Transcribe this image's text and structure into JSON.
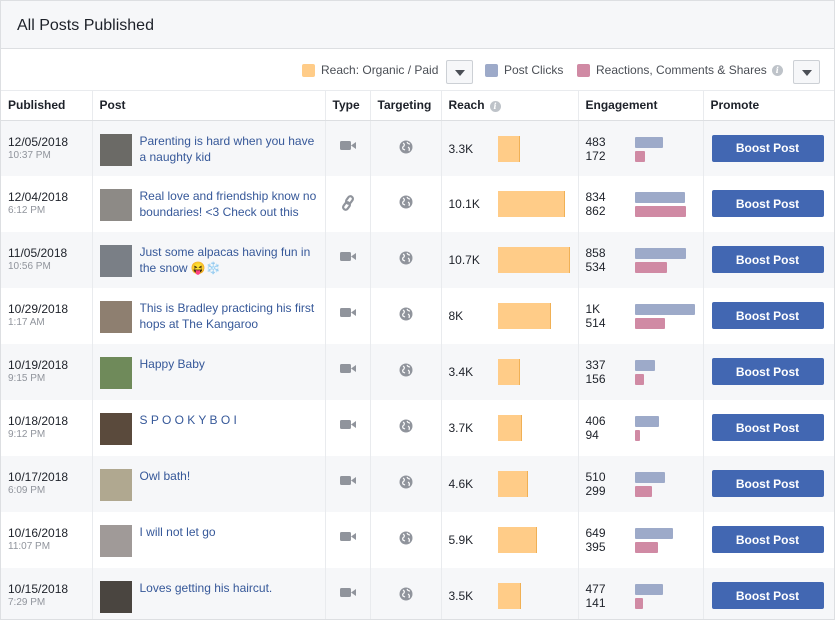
{
  "title": "All Posts Published",
  "legend": {
    "reach_label": "Reach: Organic / Paid",
    "clicks_label": "Post Clicks",
    "reactions_label": "Reactions, Comments & Shares",
    "reach_color": "#ffcc88",
    "clicks_color": "#9daac9",
    "reactions_color": "#d08aa4"
  },
  "columns": {
    "published": "Published",
    "post": "Post",
    "type": "Type",
    "targeting": "Targeting",
    "reach": "Reach",
    "engagement": "Engagement",
    "promote": "Promote"
  },
  "boost_label": "Boost Post",
  "reach_max": 10.7,
  "engagement_max": 1000,
  "posts": [
    {
      "date": "12/05/2018",
      "time": "10:37 PM",
      "text": "Parenting is hard when you have a naughty kid",
      "type": "video-icon",
      "reach": "3.3K",
      "reach_value": 3.3,
      "clicks": "483",
      "clicks_value": 483,
      "reactions": "172",
      "reactions_value": 172,
      "thumb": "#6b6a66"
    },
    {
      "date": "12/04/2018",
      "time": "6:12 PM",
      "text": "Real love and friendship know no boundaries! <3 Check out this",
      "type": "link-icon",
      "reach": "10.1K",
      "reach_value": 10.1,
      "clicks": "834",
      "clicks_value": 834,
      "reactions": "862",
      "reactions_value": 862,
      "thumb": "#8d8a86"
    },
    {
      "date": "11/05/2018",
      "time": "10:56 PM",
      "text": "Just some alpacas having fun in the snow 😝❄️",
      "type": "video-icon",
      "reach": "10.7K",
      "reach_value": 10.7,
      "clicks": "858",
      "clicks_value": 858,
      "reactions": "534",
      "reactions_value": 534,
      "thumb": "#7a7f86"
    },
    {
      "date": "10/29/2018",
      "time": "1:17 AM",
      "text": "This is Bradley practicing his first hops at The Kangaroo",
      "type": "video-icon",
      "reach": "8K",
      "reach_value": 8.0,
      "clicks": "1K",
      "clicks_value": 1000,
      "reactions": "514",
      "reactions_value": 514,
      "thumb": "#8e7f70"
    },
    {
      "date": "10/19/2018",
      "time": "9:15 PM",
      "text": "Happy Baby",
      "type": "video-icon",
      "reach": "3.4K",
      "reach_value": 3.4,
      "clicks": "337",
      "clicks_value": 337,
      "reactions": "156",
      "reactions_value": 156,
      "thumb": "#6f8a5a"
    },
    {
      "date": "10/18/2018",
      "time": "9:12 PM",
      "text": "S P O O K Y B O I",
      "type": "video-icon",
      "reach": "3.7K",
      "reach_value": 3.7,
      "clicks": "406",
      "clicks_value": 406,
      "reactions": "94",
      "reactions_value": 94,
      "thumb": "#5a4a3c"
    },
    {
      "date": "10/17/2018",
      "time": "6:09 PM",
      "text": "Owl bath!",
      "type": "video-icon",
      "reach": "4.6K",
      "reach_value": 4.6,
      "clicks": "510",
      "clicks_value": 510,
      "reactions": "299",
      "reactions_value": 299,
      "thumb": "#b0a890"
    },
    {
      "date": "10/16/2018",
      "time": "11:07 PM",
      "text": "I will not let go",
      "type": "video-icon",
      "reach": "5.9K",
      "reach_value": 5.9,
      "clicks": "649",
      "clicks_value": 649,
      "reactions": "395",
      "reactions_value": 395,
      "thumb": "#a09a98"
    },
    {
      "date": "10/15/2018",
      "time": "7:29 PM",
      "text": "Loves getting his haircut.",
      "type": "video-icon",
      "reach": "3.5K",
      "reach_value": 3.5,
      "clicks": "477",
      "clicks_value": 477,
      "reactions": "141",
      "reactions_value": 141,
      "thumb": "#4a4540"
    }
  ]
}
